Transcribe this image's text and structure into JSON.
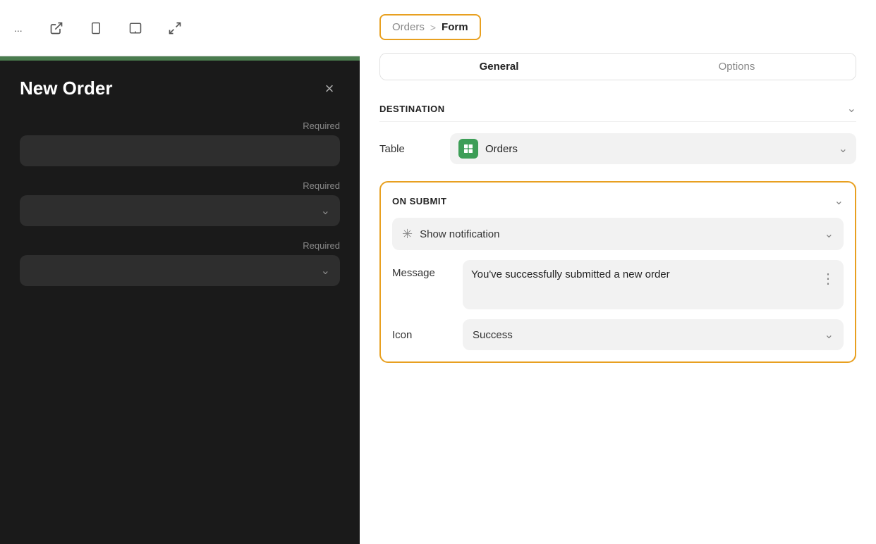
{
  "toolbar": {
    "dots_label": "...",
    "external_link_icon": "⬡",
    "phone_icon": "📱",
    "tablet_icon": "⬜",
    "expand_icon": "⤢"
  },
  "left_panel": {
    "title": "New Order",
    "close_icon": "×",
    "fields": [
      {
        "required_label": "Required"
      },
      {
        "required_label": "Required"
      },
      {
        "required_label": "Required"
      }
    ]
  },
  "right_panel": {
    "breadcrumb": {
      "parent": "Orders",
      "separator": ">",
      "current": "Form"
    },
    "tabs": [
      {
        "label": "General",
        "active": true
      },
      {
        "label": "Options",
        "active": false
      }
    ],
    "destination": {
      "section_title": "DESTINATION",
      "table_label": "Table",
      "table_value": "Orders",
      "table_icon": "⊞"
    },
    "on_submit": {
      "section_title": "ON SUBMIT",
      "notification_label": "Show notification",
      "message_label": "Message",
      "message_text": "You've successfully submitted a new order",
      "icon_label": "Icon",
      "icon_value": "Success"
    }
  }
}
